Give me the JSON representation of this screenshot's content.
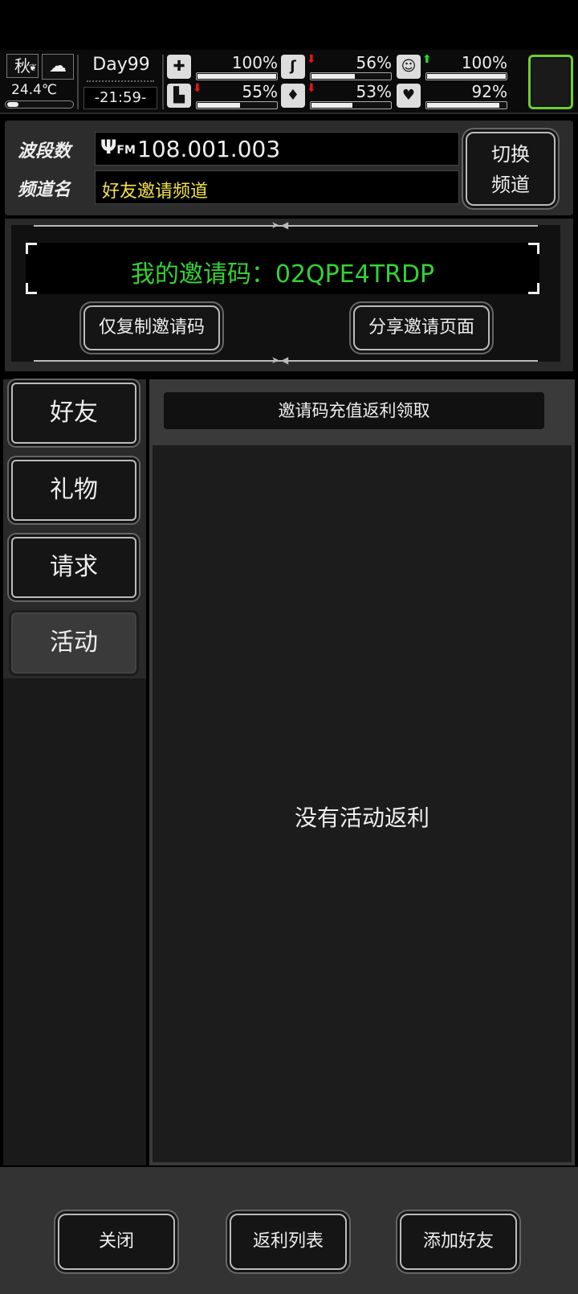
{
  "status": {
    "season": "秋",
    "temperature": "24.4℃",
    "day": "Day99",
    "time": "-21:59-",
    "stats": [
      {
        "icon": "medkit-icon",
        "glyph": "✚",
        "arrow": "",
        "percent": "100%",
        "level": 1.0
      },
      {
        "icon": "stomach-icon",
        "glyph": "ʃ",
        "arrow": "down",
        "percent": "56%",
        "level": 0.56
      },
      {
        "icon": "mood-icon",
        "glyph": "☺",
        "arrow": "up",
        "percent": "100%",
        "level": 1.0
      },
      {
        "icon": "boot-icon",
        "glyph": "▙",
        "arrow": "down",
        "percent": "55%",
        "level": 0.55
      },
      {
        "icon": "water-drop-icon",
        "glyph": "💧",
        "arrow": "down",
        "percent": "53%",
        "level": 0.53
      },
      {
        "icon": "heart-icon",
        "glyph": "♥",
        "arrow": "",
        "percent": "92%",
        "level": 0.92
      }
    ],
    "accent_color": "#6fce2b"
  },
  "channel": {
    "freq_label": "波段数",
    "freq_value": "108.001.003",
    "name_label": "频道名",
    "name_value": "好友邀请频道",
    "switch_label_line1": "切换",
    "switch_label_line2": "频道"
  },
  "invite": {
    "code_text": "我的邀请码：02QPE4TRDP",
    "copy_button": "仅复制邀请码",
    "share_button": "分享邀请页面"
  },
  "tabs": [
    "好友",
    "礼物",
    "请求",
    "活动"
  ],
  "content": {
    "header": "邀请码充值返利领取",
    "empty_message": "没有活动返利"
  },
  "bottom": {
    "close": "关闭",
    "rebate_list": "返利列表",
    "add_friend": "添加好友"
  }
}
